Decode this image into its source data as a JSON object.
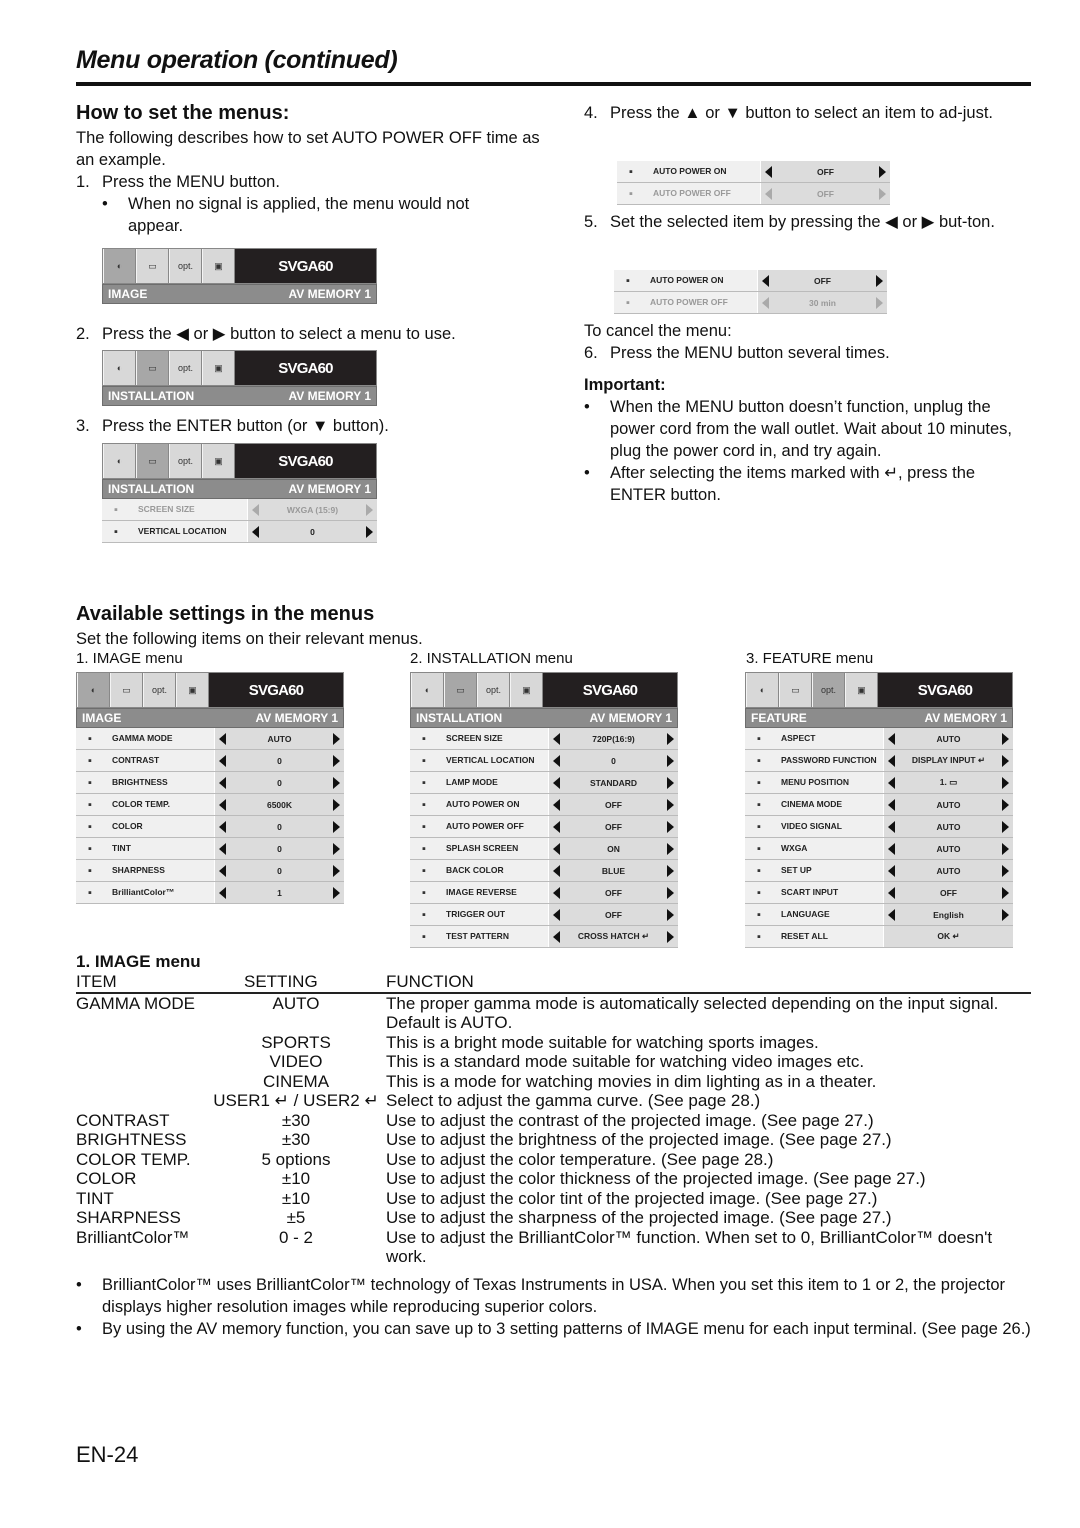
{
  "page_title": "Menu operation (continued)",
  "how_to": {
    "heading": "How to set the menus:",
    "intro": "The following describes how to set AUTO POWER OFF time as an example.",
    "step1": {
      "num": "1.",
      "text": "Press the MENU button."
    },
    "step1_bullet": "When no signal is applied, the menu would not appear.",
    "step2": {
      "num": "2.",
      "text": "Press the ◀ or ▶ button to select a menu to use."
    },
    "step3": {
      "num": "3.",
      "text": "Press the ENTER button (or ▼ button)."
    },
    "step4": {
      "num": "4.",
      "text": "Press the ▲ or ▼ button to select an item to ad-just."
    },
    "step5": {
      "num": "5.",
      "text": "Set the selected item by pressing the ◀ or ▶ but-ton."
    },
    "cancel_label": "To cancel the menu:",
    "step6": {
      "num": "6.",
      "text": "Press the MENU button several times."
    },
    "important_label": "Important:",
    "important_bullets": [
      "When the MENU button doesn’t function,  unplug the power cord from the wall outlet. Wait about 10 minutes, plug the power cord in, and try again.",
      "After selecting the items marked with ↵, press the ENTER button."
    ]
  },
  "osd_common": {
    "signal": "SVGA60",
    "av_memory": "AV MEMORY 1",
    "tabs": [
      "image-tab",
      "installation-tab",
      "opt.",
      "feature-tab"
    ]
  },
  "osd_step1": {
    "menu": "IMAGE"
  },
  "osd_step2": {
    "menu": "INSTALLATION"
  },
  "osd_step3": {
    "menu": "INSTALLATION",
    "rows": [
      {
        "label": "SCREEN SIZE",
        "value": "WXGA (15:9)",
        "dim": true
      },
      {
        "label": "VERTICAL LOCATION",
        "value": "0",
        "dim": false
      }
    ]
  },
  "osd_step4": {
    "rows": [
      {
        "label": "AUTO POWER ON",
        "value": "OFF",
        "dim": false
      },
      {
        "label": "AUTO POWER OFF",
        "value": "OFF",
        "dim": true
      }
    ]
  },
  "osd_step5": {
    "rows": [
      {
        "label": "AUTO POWER ON",
        "value": "OFF",
        "dim": false
      },
      {
        "label": "AUTO POWER OFF",
        "value": "30 min",
        "dim": true
      }
    ]
  },
  "available": {
    "heading": "Available settings in the menus",
    "intro": "Set the following items on their relevant menus.",
    "menu_titles": [
      "1. IMAGE menu",
      "2. INSTALLATION menu",
      "3. FEATURE menu"
    ]
  },
  "image_menu": {
    "menu": "IMAGE",
    "rows": [
      {
        "label": "GAMMA MODE",
        "value": "AUTO"
      },
      {
        "label": "CONTRAST",
        "value": "0"
      },
      {
        "label": "BRIGHTNESS",
        "value": "0"
      },
      {
        "label": "COLOR TEMP.",
        "value": "6500K"
      },
      {
        "label": "COLOR",
        "value": "0"
      },
      {
        "label": "TINT",
        "value": "0"
      },
      {
        "label": "SHARPNESS",
        "value": "0"
      },
      {
        "label": "BrilliantColor™",
        "value": "1"
      }
    ]
  },
  "installation_menu": {
    "menu": "INSTALLATION",
    "rows": [
      {
        "label": "SCREEN SIZE",
        "value": "720P(16:9)"
      },
      {
        "label": "VERTICAL LOCATION",
        "value": "0"
      },
      {
        "label": "LAMP MODE",
        "value": "STANDARD"
      },
      {
        "label": "AUTO POWER ON",
        "value": "OFF"
      },
      {
        "label": "AUTO POWER OFF",
        "value": "OFF"
      },
      {
        "label": "SPLASH SCREEN",
        "value": "ON"
      },
      {
        "label": "BACK COLOR",
        "value": "BLUE"
      },
      {
        "label": "IMAGE REVERSE",
        "value": "OFF"
      },
      {
        "label": "TRIGGER OUT",
        "value": "OFF"
      },
      {
        "label": "TEST PATTERN",
        "value": "CROSS HATCH ↵"
      }
    ]
  },
  "feature_menu": {
    "menu": "FEATURE",
    "rows": [
      {
        "label": "ASPECT",
        "value": "AUTO"
      },
      {
        "label": "PASSWORD FUNCTION",
        "value": "DISPLAY INPUT ↵"
      },
      {
        "label": "MENU POSITION",
        "value": "1. ▭"
      },
      {
        "label": "CINEMA MODE",
        "value": "AUTO"
      },
      {
        "label": "VIDEO SIGNAL",
        "value": "AUTO"
      },
      {
        "label": "WXGA",
        "value": "AUTO"
      },
      {
        "label": "SET UP",
        "value": "AUTO"
      },
      {
        "label": "SCART INPUT",
        "value": "OFF"
      },
      {
        "label": "LANGUAGE",
        "value": "English"
      },
      {
        "label": "RESET ALL",
        "value": "OK ↵",
        "no_arrows": true
      }
    ]
  },
  "image_table": {
    "title": "1. IMAGE menu",
    "headers": [
      "ITEM",
      "SETTING",
      "FUNCTION"
    ],
    "rows": [
      {
        "item": "GAMMA MODE",
        "setting": "AUTO",
        "function": "The proper gamma mode is automatically selected depending on the input signal. Default is AUTO."
      },
      {
        "item": "",
        "setting": "SPORTS",
        "function": "This is a bright mode suitable for watching sports images."
      },
      {
        "item": "",
        "setting": "VIDEO",
        "function": "This is a standard mode suitable for watching video images etc."
      },
      {
        "item": "",
        "setting": "CINEMA",
        "function": "This is a mode for watching movies in dim lighting as in a theater."
      },
      {
        "item": "",
        "setting": "USER1 ↵ / USER2 ↵",
        "function": "Select to adjust the gamma curve. (See page 28.)"
      },
      {
        "item": "CONTRAST",
        "setting": "±30",
        "function": "Use to adjust the contrast of the projected image. (See page 27.)"
      },
      {
        "item": "BRIGHTNESS",
        "setting": "±30",
        "function": "Use to adjust the brightness of the projected image. (See page 27.)"
      },
      {
        "item": "COLOR TEMP.",
        "setting": "5 options",
        "function": "Use to adjust the color temperature. (See page 28.)"
      },
      {
        "item": "COLOR",
        "setting": "±10",
        "function": "Use to adjust the color thickness of the projected image. (See page 27.)"
      },
      {
        "item": "TINT",
        "setting": "±10",
        "function": "Use to adjust the color tint of the projected image. (See page 27.)"
      },
      {
        "item": "SHARPNESS",
        "setting": "±5",
        "function": "Use to adjust the sharpness of the projected image. (See page 27.)"
      },
      {
        "item": "BrilliantColor™",
        "setting": "0 - 2",
        "function": "Use to adjust the BrilliantColor™ function.  When set to 0, BrilliantColor™ doesn't work."
      }
    ]
  },
  "notes": [
    "BrilliantColor™ uses BrilliantColor™ technology of Texas Instruments in USA. When you set this item to 1 or 2, the projector displays higher resolution images while reproducing superior colors.",
    "By using the AV memory function, you can save up to 3 setting patterns of IMAGE menu for each input terminal. (See page 26.)"
  ],
  "page_number": "EN-24"
}
